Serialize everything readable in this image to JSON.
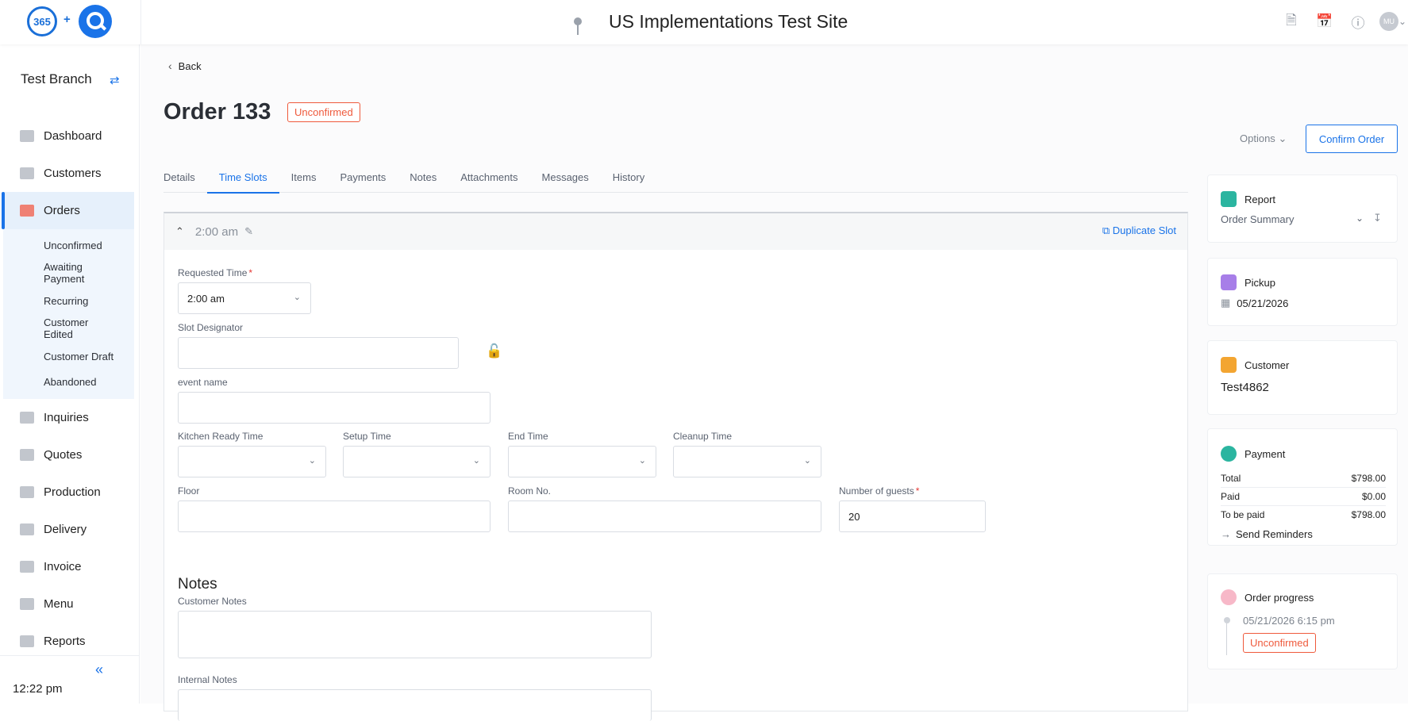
{
  "topbar": {
    "logo_text": "365",
    "logo_plus": "+",
    "site_title": "US Implementations Test Site",
    "avatar_initials": "MU"
  },
  "sidebar": {
    "branch": "Test Branch",
    "items": [
      {
        "label": "Dashboard"
      },
      {
        "label": "Customers"
      },
      {
        "label": "Orders"
      },
      {
        "label": "Inquiries"
      },
      {
        "label": "Quotes"
      },
      {
        "label": "Production"
      },
      {
        "label": "Delivery"
      },
      {
        "label": "Invoice"
      },
      {
        "label": "Menu"
      },
      {
        "label": "Reports"
      }
    ],
    "order_sub": [
      "Unconfirmed",
      "Awaiting Payment",
      "Recurring",
      "Customer Edited",
      "Customer Draft",
      "Abandoned"
    ],
    "clock": "12:22 pm"
  },
  "main": {
    "back": "Back",
    "title": "Order 133",
    "status": "Unconfirmed",
    "options": "Options",
    "confirm": "Confirm Order",
    "tabs": [
      "Details",
      "Time Slots",
      "Items",
      "Payments",
      "Notes",
      "Attachments",
      "Messages",
      "History"
    ]
  },
  "slot": {
    "time": "2:00 am",
    "duplicate": "Duplicate Slot",
    "requested_time_label": "Requested Time",
    "requested_time_value": "2:00 am",
    "slot_designator_label": "Slot Designator",
    "event_name_label": "event name",
    "kitchen_label": "Kitchen Ready Time",
    "setup_label": "Setup Time",
    "end_label": "End Time",
    "cleanup_label": "Cleanup Time",
    "floor_label": "Floor",
    "room_label": "Room No.",
    "guests_label": "Number of guests",
    "guests_value": "20",
    "notes_title": "Notes",
    "customer_notes_label": "Customer Notes",
    "internal_notes_label": "Internal Notes",
    "required_mark": "*"
  },
  "right": {
    "report": {
      "title": "Report",
      "value": "Order Summary"
    },
    "pickup": {
      "title": "Pickup",
      "date": "05/21/2026"
    },
    "customer": {
      "title": "Customer",
      "name": "Test4862"
    },
    "payment": {
      "title": "Payment",
      "total_label": "Total",
      "total": "$798.00",
      "paid_label": "Paid",
      "paid": "$0.00",
      "tobepaid_label": "To be paid",
      "tobepaid": "$798.00",
      "reminders": "Send Reminders"
    },
    "progress": {
      "title": "Order progress",
      "date": "05/21/2026 6:15 pm",
      "status": "Unconfirmed"
    }
  },
  "colors": {
    "accent": "#1a73e8",
    "status": "#ef5a3c"
  }
}
